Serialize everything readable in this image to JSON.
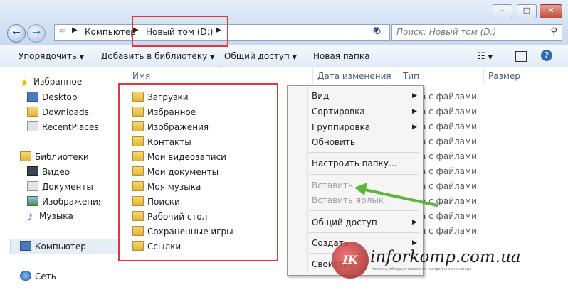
{
  "window": {
    "controls": [
      "–",
      "□",
      "✕"
    ]
  },
  "address": {
    "crumbs": [
      "Компьютер",
      "Новый том (D:)"
    ]
  },
  "search": {
    "placeholder": "Поиск: Новый том (D:)"
  },
  "toolbar": {
    "organize": "Упорядочить",
    "add_to_library": "Добавить в библиотеку",
    "share": "Общий доступ",
    "new_folder": "Новая папка"
  },
  "sidebar": {
    "favorites": "Избранное",
    "desktop": "Desktop",
    "downloads": "Downloads",
    "recent": "RecentPlaces",
    "libraries": "Библиотеки",
    "video": "Видео",
    "documents": "Документы",
    "images": "Изображения",
    "music": "Музыка",
    "computer": "Компьютер",
    "network": "Сеть"
  },
  "columns": {
    "name": "Имя",
    "date": "Дата изменения",
    "type": "Тип",
    "size": "Размер"
  },
  "files": [
    "Загрузки",
    "Избранное",
    "Изображения",
    "Контакты",
    "Мои видеозаписи",
    "Мои документы",
    "Моя музыка",
    "Поиски",
    "Рабочий стол",
    "Сохраненные игры",
    "Ссылки"
  ],
  "file_type_partial": "а с файлами",
  "context_menu": {
    "view": "Вид",
    "sort": "Сортировка",
    "group": "Группировка",
    "refresh": "Обновить",
    "customize": "Настроить папку...",
    "paste": "Вставить",
    "paste_shortcut": "Вставить ярлык",
    "share": "Общий доступ",
    "create": "Создать",
    "properties": "Свойства"
  },
  "watermark": {
    "site": "inforkomp.com.ua",
    "tagline": "Новости, обзоры и советы по настройке компьютера",
    "logo": "IK"
  },
  "colors": {
    "highlight": "#e03838",
    "arrow": "#5fb53a"
  }
}
